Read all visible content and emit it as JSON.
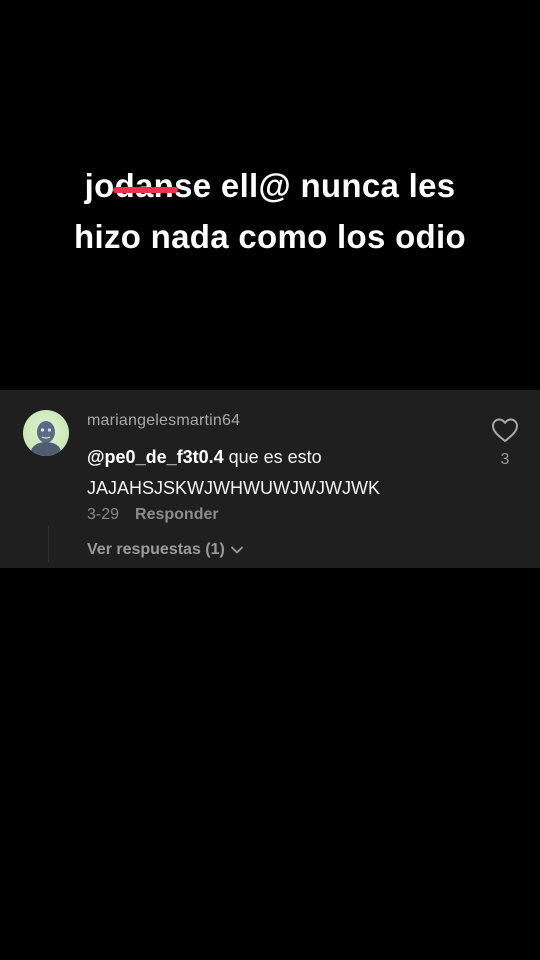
{
  "caption": {
    "struck_prefix": "jo",
    "struck_word": "dan",
    "struck_suffix": "se ell@ nunca les",
    "line2": "hizo nada como los odio",
    "strike_color": "#e8344c"
  },
  "comment": {
    "username": "mariangelesmartin64",
    "mention": "@pe0_de_f3t0.4",
    "text": " que es esto JAJAHSJSKWJWHWUWJWJWJWK",
    "date": "3-29",
    "reply_label": "Responder",
    "view_replies_label": "Ver respuestas (1)",
    "like_count": "3",
    "avatar_icon": "avatar-icon",
    "like_icon": "heart-outline-icon",
    "chevron_icon": "chevron-down-icon"
  },
  "colors": {
    "background": "#000000",
    "panel": "#1f1f1f"
  }
}
